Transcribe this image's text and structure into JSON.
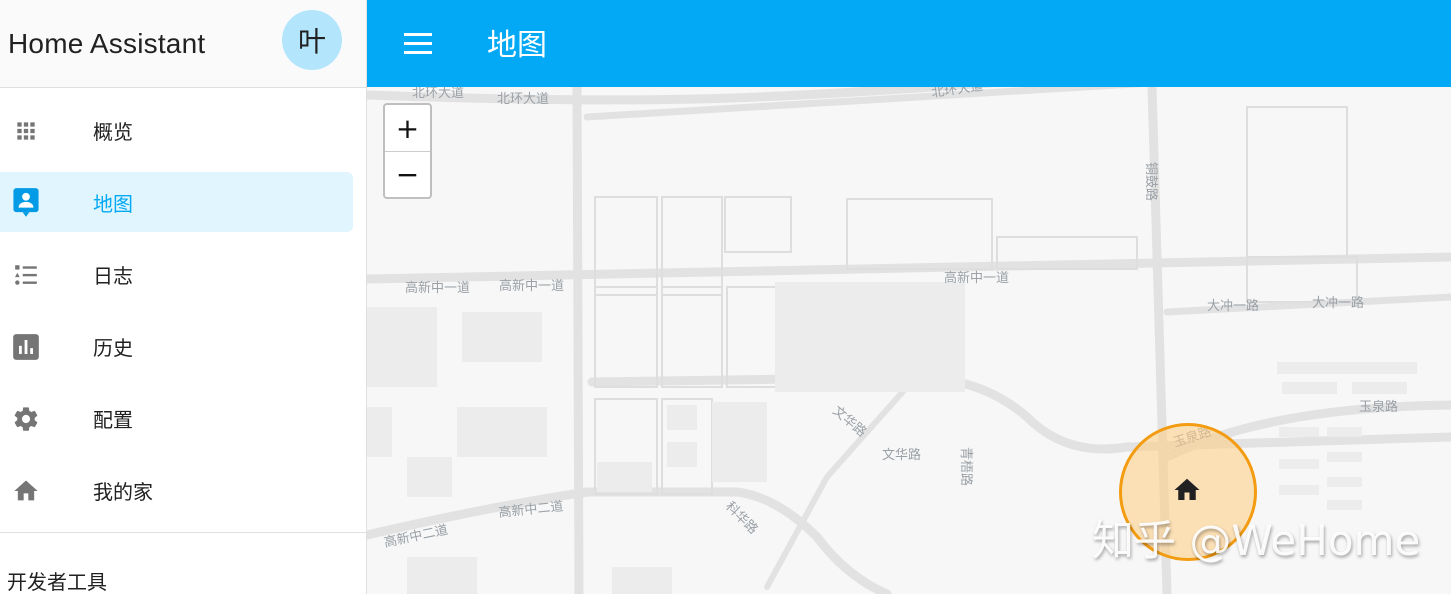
{
  "sidebar": {
    "title": "Home Assistant",
    "avatar_initial": "叶",
    "items": [
      {
        "label": "概览",
        "icon": "apps-grid-icon",
        "active": false
      },
      {
        "label": "地图",
        "icon": "account-location-icon",
        "active": true
      },
      {
        "label": "日志",
        "icon": "format-list-bulleted-type-icon",
        "active": false
      },
      {
        "label": "历史",
        "icon": "chart-box-icon",
        "active": false
      },
      {
        "label": "配置",
        "icon": "gear-icon",
        "active": false
      },
      {
        "label": "我的家",
        "icon": "home-icon",
        "active": false
      }
    ],
    "developer_tools_label": "开发者工具"
  },
  "toolbar": {
    "title": "地图",
    "menu_icon": "menu-icon"
  },
  "map": {
    "zoom_in_label": "+",
    "zoom_out_label": "−",
    "road_labels": {
      "beihuan1": "北环大道",
      "beihuan2": "北环大道",
      "beihuan3": "北环大道",
      "gaoxin1a": "高新中一道",
      "gaoxin1b": "高新中一道",
      "gaoxin1c": "高新中一道",
      "gaoxin2a": "高新中二道",
      "gaoxin2b": "高新中二道",
      "tonggu": "铜鼓路",
      "dachong1": "大冲一路",
      "dachong2": "大冲一路",
      "yuquan1": "玉泉路",
      "yuquan2": "玉泉路",
      "wenhua1": "文华路",
      "wenhua2": "文华路",
      "qingyuan": "青梧路",
      "kehua": "科华路"
    },
    "home_zone": {
      "name": "home",
      "icon": "home-icon",
      "color": "#f39c12"
    },
    "watermark": "知乎 @WeHome"
  },
  "colors": {
    "accent": "#03a9f4",
    "active_bg": "#e1f5fe",
    "avatar_bg": "#b3e5fc",
    "icon_gray": "#757575",
    "zone_orange": "#f39c12"
  }
}
